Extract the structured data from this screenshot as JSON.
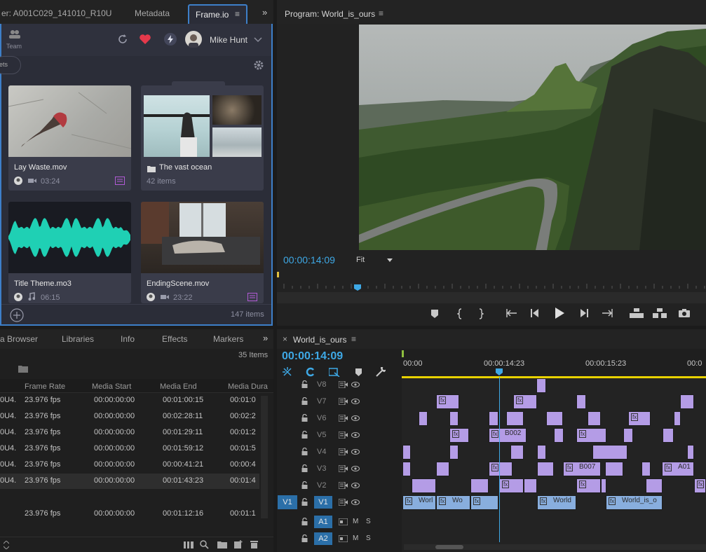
{
  "top_tabs": {
    "source": "er: A001C029_141010_R10U",
    "metadata": "Metadata",
    "frameio": "Frame.io",
    "menu_glyph": "≡",
    "overflow_glyph": "»"
  },
  "frameio": {
    "team_label": "Team",
    "user_name": "Mike Hunt",
    "breadcrumb_fragment": "ets",
    "item_count": "147 items",
    "heart_color": "#e5394b",
    "cards": [
      {
        "title": "Lay Waste.mov",
        "meta": "03:24",
        "kind": "video"
      },
      {
        "title": "The vast ocean",
        "meta": "42 items",
        "kind": "folder"
      },
      {
        "title": "Title Theme.mo3",
        "meta": "06:15",
        "kind": "audio"
      },
      {
        "title": "EndingScene.mov",
        "meta": "23:22",
        "kind": "video"
      }
    ]
  },
  "program": {
    "title": "Program: World_is_ours",
    "menu_glyph": "≡",
    "timecode": "00:00:14:09",
    "fit_label": "Fit",
    "accent": "#3ea8e5"
  },
  "browser": {
    "tabs": [
      "a Browser",
      "Libraries",
      "Info",
      "Effects",
      "Markers"
    ],
    "overflow_glyph": "»",
    "items_count": "35 Items",
    "columns": [
      "Frame Rate",
      "Media Start",
      "Media End",
      "Media Dura"
    ],
    "rows": [
      {
        "name": "0U4.",
        "fps": "23.976 fps",
        "start": "00:00:00:00",
        "end": "00:01:00:15",
        "dur": "00:01:0"
      },
      {
        "name": "0U4.",
        "fps": "23.976 fps",
        "start": "00:00:00:00",
        "end": "00:02:28:11",
        "dur": "00:02:2"
      },
      {
        "name": "0U4.",
        "fps": "23.976 fps",
        "start": "00:00:00:00",
        "end": "00:01:29:11",
        "dur": "00:01:2"
      },
      {
        "name": "0U4.",
        "fps": "23.976 fps",
        "start": "00:00:00:00",
        "end": "00:01:59:12",
        "dur": "00:01:5"
      },
      {
        "name": "0U4.",
        "fps": "23.976 fps",
        "start": "00:00:00:00",
        "end": "00:00:41:21",
        "dur": "00:00:4"
      },
      {
        "name": "0U4.",
        "fps": "23.976 fps",
        "start": "00:00:00:00",
        "end": "00:01:43:23",
        "dur": "00:01:4"
      },
      {
        "name": "",
        "fps": "",
        "start": "",
        "end": "",
        "dur": ""
      },
      {
        "name": "",
        "fps": "23.976 fps",
        "start": "00:00:00:00",
        "end": "00:01:12:16",
        "dur": "00:01:1"
      }
    ]
  },
  "timeline": {
    "close_glyph": "×",
    "title": "World_is_ours",
    "menu_glyph": "≡",
    "timecode": "00:00:14:09",
    "ruler": [
      "00:00",
      "00:00:14:23",
      "00:00:15:23",
      "00:0"
    ],
    "tracks": [
      "V8",
      "V7",
      "V6",
      "V5",
      "V4",
      "V3",
      "V2",
      "V1",
      "A1",
      "A2"
    ],
    "source_patch": "V1",
    "audio_m": "M",
    "audio_s": "S",
    "fx_label": "fx",
    "clip_labels": {
      "v5_b002": "B002",
      "v3_b007": "B007",
      "v3_a01": "A01",
      "v1_a": "Worl",
      "v1_b": "Wo",
      "v1_c": "World",
      "v1_d": "World_is_o"
    },
    "clip_color": "#b49ce6",
    "v1_clip_color": "#88aede",
    "playhead_color": "#3ea8e5",
    "work_area_color": "#e8d200"
  }
}
